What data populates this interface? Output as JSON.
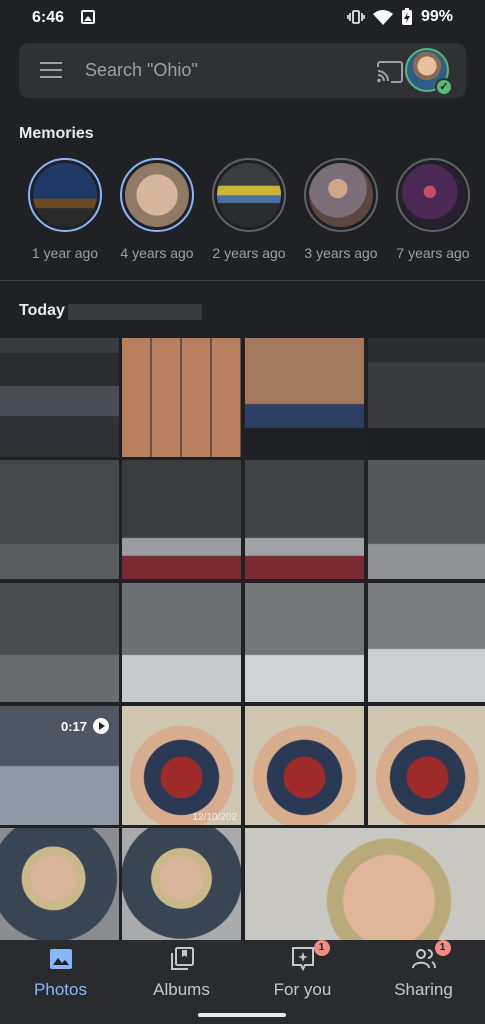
{
  "status_bar": {
    "time": "6:46",
    "battery": "99%"
  },
  "search": {
    "placeholder": "Search \"Ohio\""
  },
  "memories": {
    "title": "Memories",
    "items": [
      {
        "label": "1 year ago"
      },
      {
        "label": "4 years ago"
      },
      {
        "label": "2 years ago"
      },
      {
        "label": "3 years ago"
      },
      {
        "label": "7 years ago"
      }
    ]
  },
  "today": {
    "title": "Today"
  },
  "grid": {
    "video_duration": "0:17",
    "datestamp": "12/10/202"
  },
  "nav": {
    "items": [
      {
        "label": "Photos",
        "icon": "photos-icon",
        "active": true
      },
      {
        "label": "Albums",
        "icon": "albums-icon"
      },
      {
        "label": "For you",
        "icon": "for-you-icon",
        "badge": "1"
      },
      {
        "label": "Sharing",
        "icon": "sharing-icon",
        "badge": "1"
      }
    ]
  },
  "colors": {
    "accent": "#8ab4f8",
    "background": "#202124",
    "badge": "#f28b82"
  }
}
